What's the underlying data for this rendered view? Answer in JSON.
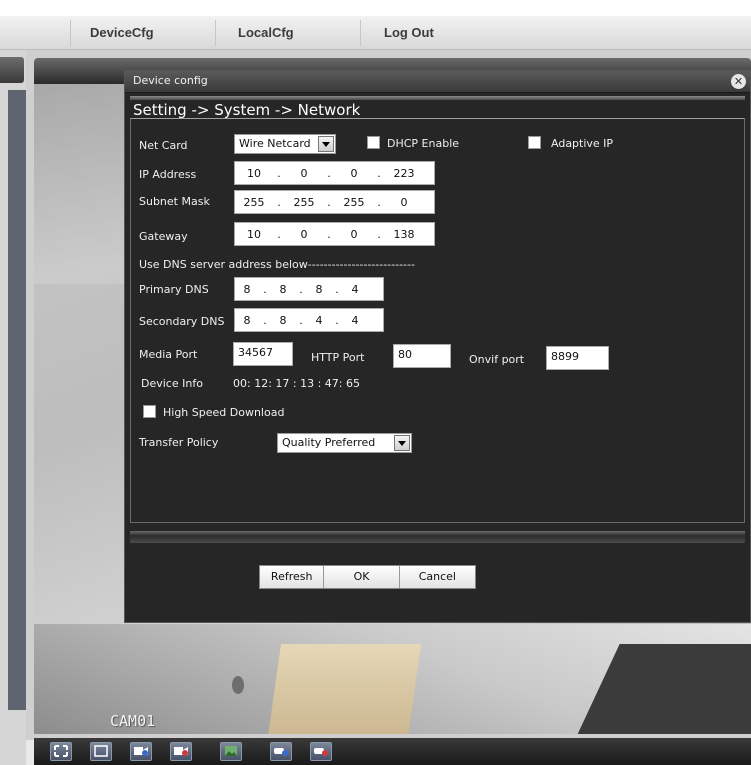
{
  "nav": {
    "items": [
      "DeviceCfg",
      "LocalCfg",
      "Log Out"
    ]
  },
  "dialog": {
    "title": "Device config",
    "close_symbol": "✕",
    "breadcrumb": "Setting -> System -> Network",
    "net_card": {
      "label": "Net Card",
      "value": "Wire Netcard"
    },
    "dhcp": {
      "label": "DHCP Enable",
      "checked": false
    },
    "adaptive": {
      "label": "Adaptive IP",
      "checked": false
    },
    "ip_address": {
      "label": "IP Address",
      "octets": [
        "10",
        "0",
        "0",
        "223"
      ]
    },
    "subnet_mask": {
      "label": "Subnet Mask",
      "octets": [
        "255",
        "255",
        "255",
        "0"
      ]
    },
    "gateway": {
      "label": "Gateway",
      "octets": [
        "10",
        "0",
        "0",
        "138"
      ]
    },
    "dns_header": "Use DNS server address below---------------------------",
    "primary_dns": {
      "label": "Primary DNS",
      "octets": [
        "8",
        "8",
        "8",
        "4"
      ]
    },
    "secondary_dns": {
      "label": "Secondary DNS",
      "octets": [
        "8",
        "8",
        "4",
        "4"
      ]
    },
    "media_port": {
      "label": "Media Port",
      "value": "34567"
    },
    "http_port": {
      "label": "HTTP Port",
      "value": "80"
    },
    "onvif_port": {
      "label": "Onvif port",
      "value": "8899"
    },
    "device_info": {
      "label": "Device Info",
      "value": "00: 12: 17 : 13 : 47: 65"
    },
    "high_speed": {
      "label": "High Speed Download",
      "checked": false
    },
    "transfer_policy": {
      "label": "Transfer Policy",
      "value": "Quality Preferred"
    },
    "buttons": {
      "refresh": "Refresh",
      "ok": "OK",
      "cancel": "Cancel"
    }
  },
  "video": {
    "camera_label": "CAM01"
  },
  "toolbar": {
    "icons": [
      "fullscreen-icon",
      "single-view-icon",
      "record-icon",
      "stop-record-icon",
      "snapshot-icon",
      "camera-play-icon",
      "camera-stop-icon"
    ]
  },
  "colors": {
    "dialog_bg": "#262626",
    "accent": "#4a5670"
  }
}
